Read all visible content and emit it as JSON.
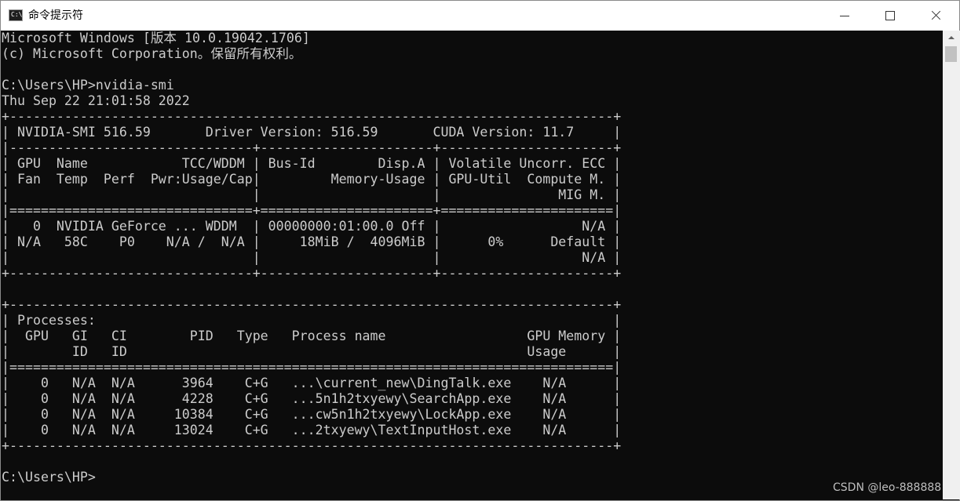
{
  "window": {
    "title": "命令提示符",
    "icon": "console-app-icon",
    "icon_label": "C:\\"
  },
  "console": {
    "lines": [
      "Microsoft Windows [版本 10.0.19042.1706]",
      "(c) Microsoft Corporation。保留所有权利。",
      "",
      "C:\\Users\\HP>nvidia-smi",
      "Thu Sep 22 21:01:58 2022",
      "+-----------------------------------------------------------------------------+",
      "| NVIDIA-SMI 516.59       Driver Version: 516.59       CUDA Version: 11.7     |",
      "|-------------------------------+----------------------+----------------------+",
      "| GPU  Name            TCC/WDDM | Bus-Id        Disp.A | Volatile Uncorr. ECC |",
      "| Fan  Temp  Perf  Pwr:Usage/Cap|         Memory-Usage | GPU-Util  Compute M. |",
      "|                               |                      |               MIG M. |",
      "|===============================+======================+======================|",
      "|   0  NVIDIA GeForce ... WDDM  | 00000000:01:00.0 Off |                  N/A |",
      "| N/A   58C    P0    N/A /  N/A |     18MiB /  4096MiB |      0%      Default |",
      "|                               |                      |                  N/A |",
      "+-------------------------------+----------------------+----------------------+",
      "",
      "+-----------------------------------------------------------------------------+",
      "| Processes:                                                                  |",
      "|  GPU   GI   CI        PID   Type   Process name                  GPU Memory |",
      "|        ID   ID                                                   Usage      |",
      "|=============================================================================|",
      "|    0   N/A  N/A      3964    C+G   ...\\current_new\\DingTalk.exe    N/A      |",
      "|    0   N/A  N/A      4228    C+G   ...5n1h2txyewy\\SearchApp.exe    N/A      |",
      "|    0   N/A  N/A     10384    C+G   ...cw5n1h2txyewy\\LockApp.exe    N/A      |",
      "|    0   N/A  N/A     13024    C+G   ...2txyewy\\TextInputHost.exe    N/A      |",
      "+-----------------------------------------------------------------------------+",
      "",
      "C:\\Users\\HP>"
    ]
  },
  "watermark": "CSDN @leo-888888",
  "colors": {
    "console_bg": "#0c0c0c",
    "console_fg": "#cccccc",
    "titlebar_bg": "#ffffff"
  }
}
